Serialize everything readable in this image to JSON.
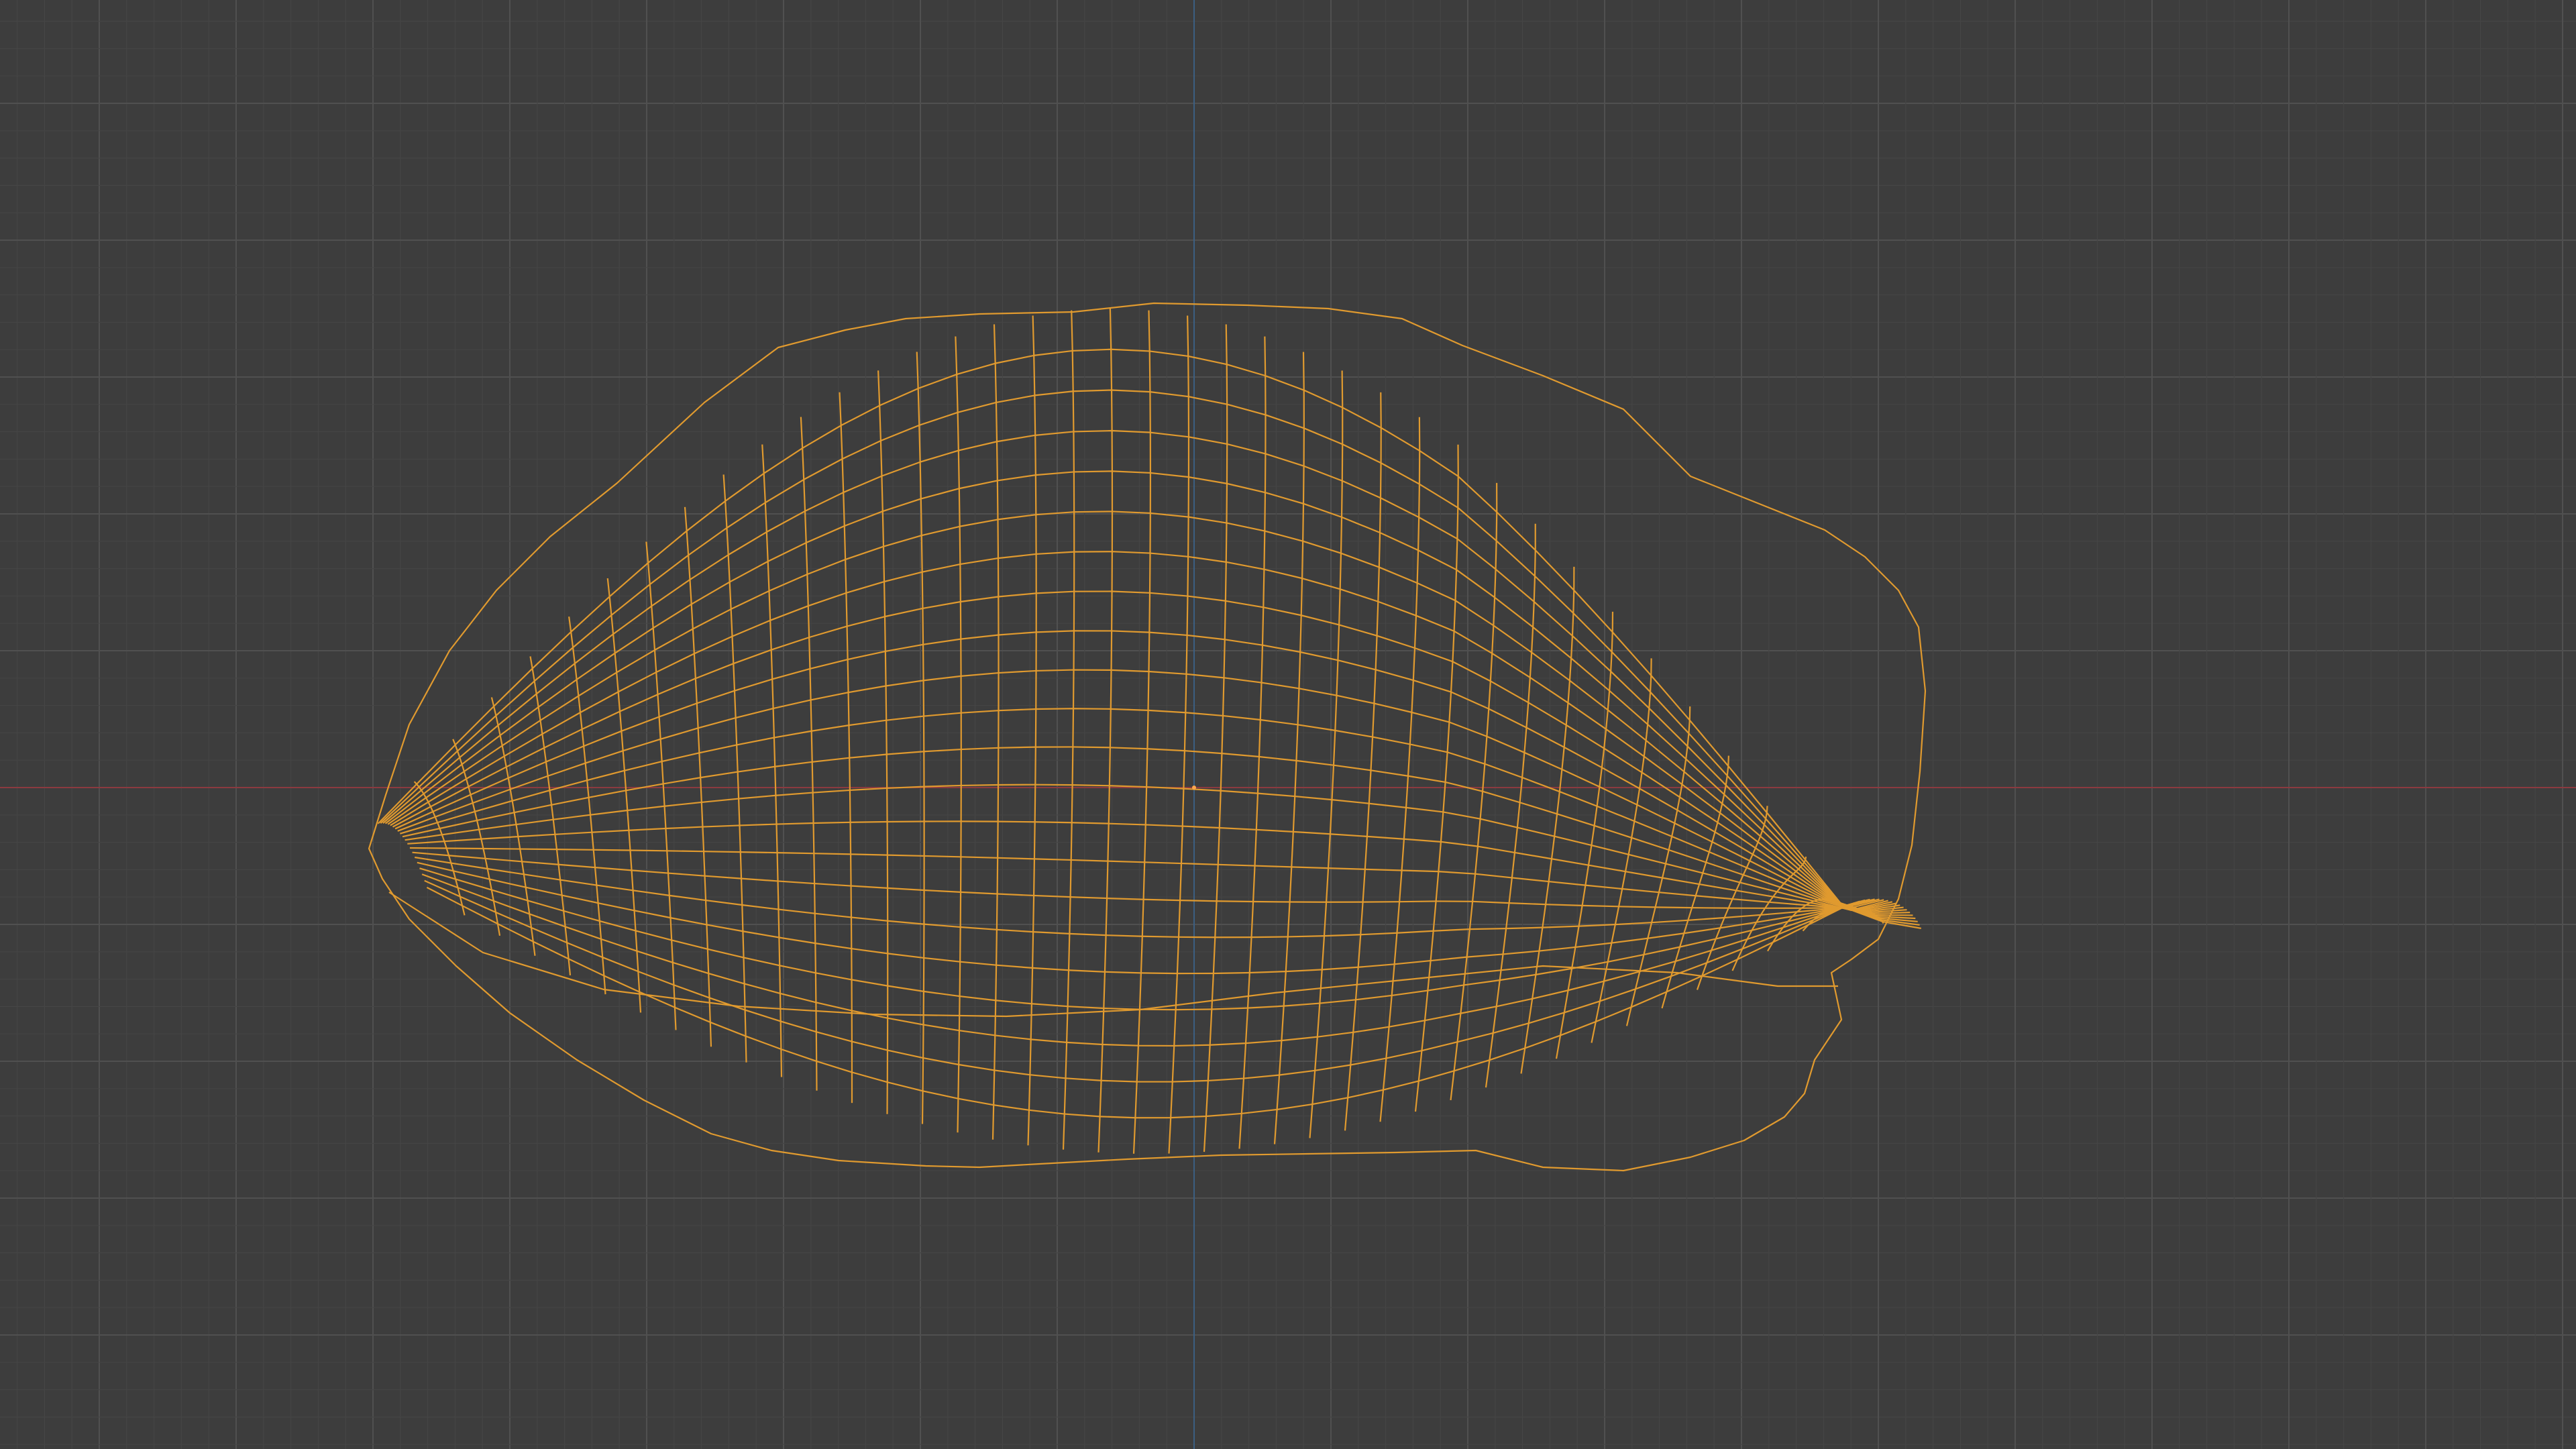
{
  "viewport": {
    "view": "front-orthographic",
    "mode": "wireframe",
    "selected": true
  },
  "colors": {
    "background": "#3d3d3d",
    "grid_minor": "#454545",
    "grid_major": "#505050",
    "axis_x": "#8b3a40",
    "axis_z": "#3c5f82",
    "wireframe": "#e09a2f",
    "origin": "#ffa64d"
  },
  "icons": {
    "origin": "object-origin-icon"
  }
}
